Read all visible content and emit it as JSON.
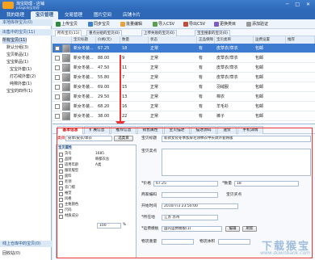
{
  "app": {
    "title": "淘宝助理 - 店铺",
    "subtitle": "pdagb淘宝助理"
  },
  "nav": [
    "我的助理",
    "宝贝管理",
    "交易管理",
    "图片空间",
    "店铺卡片"
  ],
  "sidebar": {
    "header": "本地库存宝贝(0)",
    "online_header": "出售中的宝贝(11)",
    "items": [
      "所有宝贝(11)",
      "默认分组(3)",
      "宝贝新品(1)",
      "宝宝新品(1)",
      "宝宝外套(1)",
      "灯芯绒外套(2)",
      "纯棉外套(1)",
      "宝宝的四件(1)"
    ],
    "footer1": "线上仓库中的宝贝(0)",
    "footer2": "回收站(0)"
  },
  "toolbar": [
    "上传宝贝",
    "同步宝贝",
    "批量编辑",
    "导入CSV",
    "导出CSV",
    "更换类目",
    "添加验证"
  ],
  "subtabs": [
    "所有宝贝(11)",
    "重点分组的宝贝(0)",
    "上传失败的宝贝(0)",
    "宝宝搜索的宝贝(0)"
  ],
  "grid": {
    "headers": [
      "",
      "宝贝标题",
      "价格(元)",
      "数量",
      "状态",
      "宝贝类目",
      "正品保障",
      "运费设置",
      "推荐"
    ],
    "rows": [
      {
        "title": "新女冬装...",
        "price": "67.25",
        "qty": "18",
        "status": "正常",
        "guar": "有",
        "cat": "皮草衣/草衣",
        "ship": "包邮"
      },
      {
        "title": "新女冬装...",
        "price": "88.00",
        "qty": "9",
        "status": "正常",
        "guar": "有",
        "cat": "皮草衣/草衣",
        "ship": "包邮"
      },
      {
        "title": "新女冬装...",
        "price": "47.50",
        "qty": "11",
        "status": "正常",
        "guar": "有",
        "cat": "皮草衣/草衣",
        "ship": "包邮"
      },
      {
        "title": "新女冬装...",
        "price": "55.80",
        "qty": "7",
        "status": "正常",
        "guar": "有",
        "cat": "皮草衣/草衣",
        "ship": "包邮"
      },
      {
        "title": "新女冬装...",
        "price": "69.00",
        "qty": "15",
        "status": "正常",
        "guar": "有",
        "cat": "羽绒服",
        "ship": "包邮"
      },
      {
        "title": "新女冬装...",
        "price": "29.50",
        "qty": "13",
        "status": "正常",
        "guar": "有",
        "cat": "棉衣",
        "ship": "包邮"
      },
      {
        "title": "新女冬装...",
        "price": "68.20",
        "qty": "16",
        "status": "正常",
        "guar": "有",
        "cat": "羊毛衫",
        "ship": "包邮"
      },
      {
        "title": "新女冬装...",
        "price": "38.00",
        "qty": "22",
        "status": "正常",
        "guar": "有",
        "cat": "裤子",
        "ship": "包邮"
      }
    ]
  },
  "detail": {
    "tabs": [
      "基本信息",
      "扩展信息",
      "推荐信息",
      "销售属性",
      "宝贝描述",
      "描述源码",
      "速赞",
      "宝贝描述",
      "手机详情"
    ],
    "category_label": "类目",
    "category_value": "皮草/皮衣/草衣",
    "choose_btn": "选类目",
    "title_label": "宝贝标题",
    "title_value": "新款女装冬季加厚毛领棉衣中长款外套韩版",
    "attr_header": "宝贝属性",
    "attr_rows": [
      "货号",
      "品牌",
      "适用年龄",
      "服装版型",
      "面料",
      "毛领",
      "衣门襟",
      "袖型",
      "风格",
      "主要颜色",
      "尺码",
      "材质成分"
    ],
    "attr_values": [
      "1685",
      "韩都衣舍",
      "A类",
      "",
      "",
      "",
      "",
      "",
      "",
      "",
      "",
      ""
    ],
    "pct": "100",
    "pct_unit": "%",
    "desc_label": "宝贝卖点",
    "price_label": "*价格",
    "price_value": "67.25",
    "qty_label": "*数量",
    "qty_value": "18",
    "merchant_label": "商家编码",
    "sale_label": "宝贝买点",
    "start_label": "开始时间",
    "start_value": "2010/7/3 23:50:00",
    "loc_label": "*所在地",
    "loc_value": "江苏 苏州",
    "ship_label": "*运费模板",
    "ship_value": "国内运费模板(1)",
    "ship_btns": [
      "编辑",
      "刷新"
    ],
    "weight_label": "物流重量",
    "volume_label": "物流体积"
  },
  "watermark": {
    "text": "下载猴宝",
    "url": "www.downbank.com"
  }
}
